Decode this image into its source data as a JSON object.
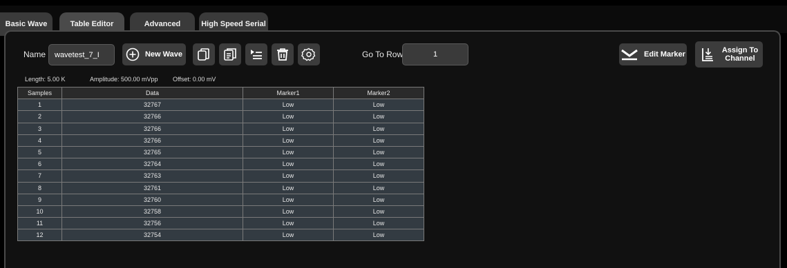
{
  "tabs": [
    {
      "label": "Basic Wave"
    },
    {
      "label": "Table Editor"
    },
    {
      "label": "Advanced"
    },
    {
      "label": "High Speed Serial"
    }
  ],
  "toolbar": {
    "name_label": "Name",
    "name_value": "wavetest_7_I",
    "new_wave_label": "New Wave",
    "goto_label": "Go To Row",
    "goto_value": "1",
    "edit_marker_label": "Edit Marker",
    "assign_label_line1": "Assign To",
    "assign_label_line2": "Channel"
  },
  "info": {
    "length": "Length: 5.00 K",
    "amplitude": "Amplitude: 500.00 mVpp",
    "offset": "Offset: 0.00 mV"
  },
  "table": {
    "headers": [
      "Samples",
      "Data",
      "Marker1",
      "Marker2"
    ],
    "rows": [
      [
        "1",
        "32767",
        "Low",
        "Low"
      ],
      [
        "2",
        "32766",
        "Low",
        "Low"
      ],
      [
        "3",
        "32766",
        "Low",
        "Low"
      ],
      [
        "4",
        "32766",
        "Low",
        "Low"
      ],
      [
        "5",
        "32765",
        "Low",
        "Low"
      ],
      [
        "6",
        "32764",
        "Low",
        "Low"
      ],
      [
        "7",
        "32763",
        "Low",
        "Low"
      ],
      [
        "8",
        "32761",
        "Low",
        "Low"
      ],
      [
        "9",
        "32760",
        "Low",
        "Low"
      ],
      [
        "10",
        "32758",
        "Low",
        "Low"
      ],
      [
        "11",
        "32756",
        "Low",
        "Low"
      ],
      [
        "12",
        "32754",
        "Low",
        "Low"
      ]
    ]
  },
  "icons": [
    "add-circle-icon",
    "copy-icon",
    "paste-icon",
    "insert-row-icon",
    "delete-icon",
    "settings-icon",
    "marker-icon",
    "assign-channel-icon"
  ]
}
